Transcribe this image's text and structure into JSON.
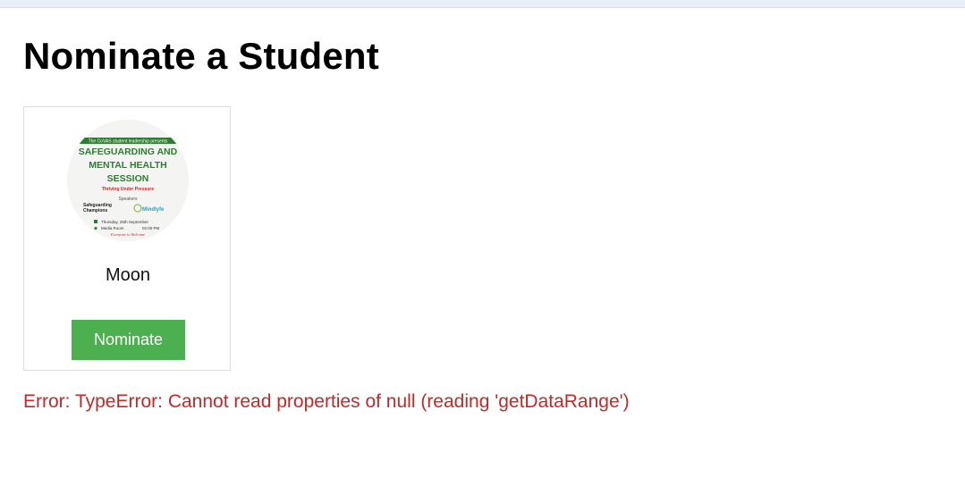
{
  "page": {
    "title": "Nominate a Student"
  },
  "card": {
    "student_name": "Moon",
    "button_label": "Nominate",
    "poster": {
      "banner": "The CoVAS student leadership presents",
      "headline_1": "SAFEGUARDING AND",
      "headline_2": "MENTAL HEALTH",
      "headline_3": "SESSION",
      "tagline": "Thriving Under Pressure",
      "speakers_label": "Speakers",
      "speaker_1_line1": "Safeguarding",
      "speaker_1_line2": "Champions",
      "speaker_2": "Mindlyfe",
      "date": "Thursday, 25th September",
      "venue": "Media Room",
      "time": "02:00 PM",
      "footer": "Everyone is Welcome"
    }
  },
  "error": {
    "message": "Error: TypeError: Cannot read properties of null (reading 'getDataRange')"
  },
  "colors": {
    "button_bg": "#4caf50",
    "error_text": "#c62828",
    "poster_green": "#2e7d32",
    "poster_red": "#c62828"
  }
}
